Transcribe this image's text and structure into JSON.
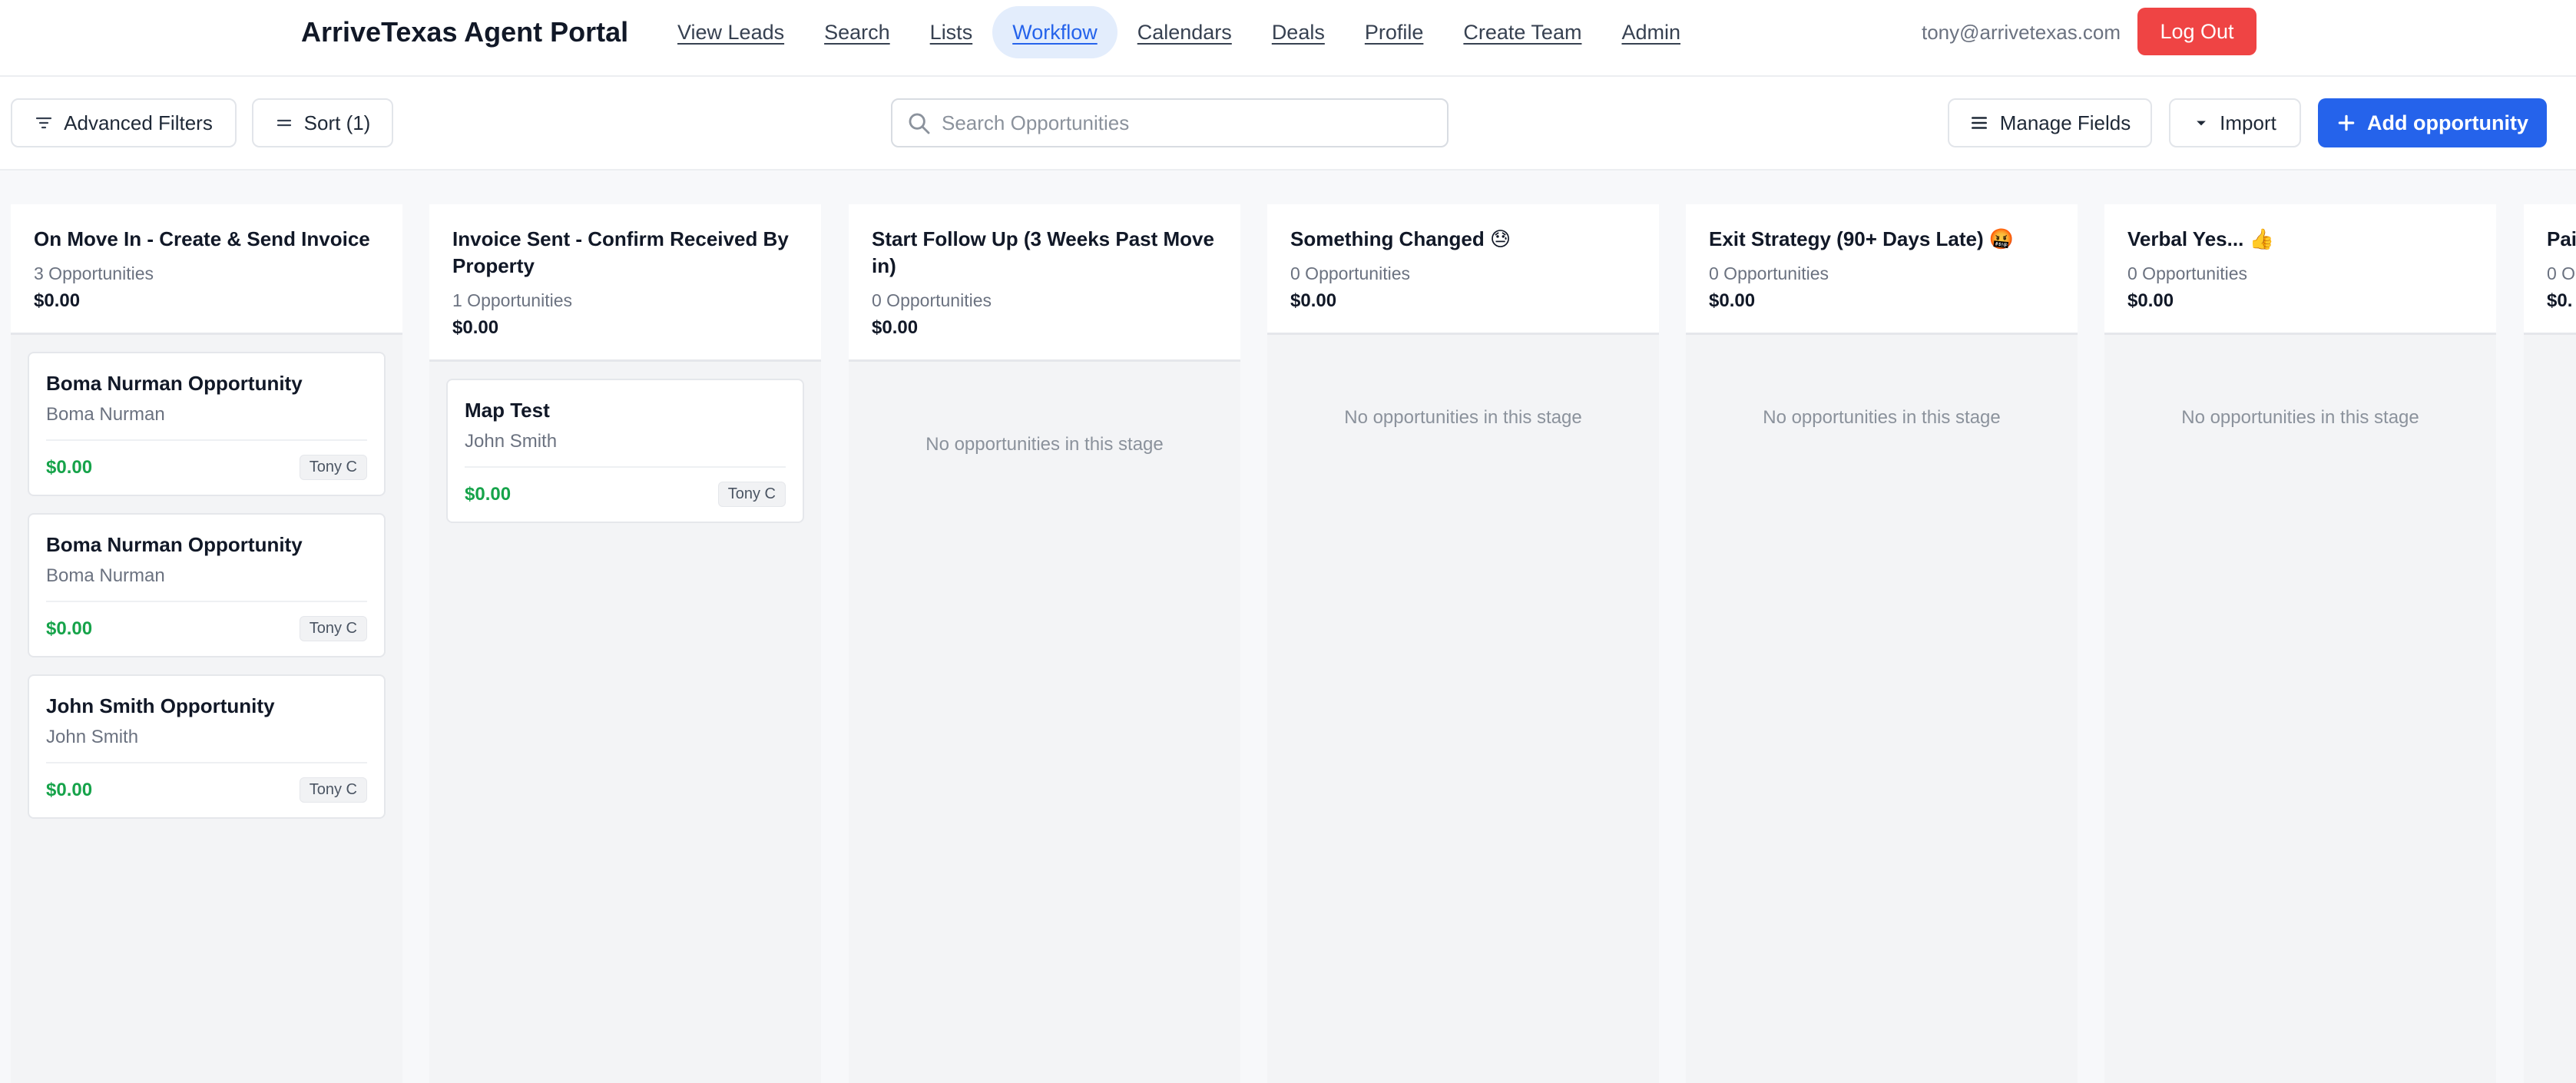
{
  "app": {
    "brand": "ArriveTexas Agent Portal",
    "nav": [
      {
        "label": "View Leads",
        "active": false
      },
      {
        "label": "Search",
        "active": false
      },
      {
        "label": "Lists",
        "active": false
      },
      {
        "label": "Workflow",
        "active": true
      },
      {
        "label": "Calendars",
        "active": false
      },
      {
        "label": "Deals",
        "active": false
      },
      {
        "label": "Profile",
        "active": false
      },
      {
        "label": "Create Team",
        "active": false
      },
      {
        "label": "Admin",
        "active": false
      }
    ],
    "user_email": "tony@arrivetexas.com",
    "logout_label": "Log Out"
  },
  "toolbar": {
    "advanced_filters_label": "Advanced Filters",
    "sort_label": "Sort (1)",
    "search_placeholder": "Search Opportunities",
    "manage_fields_label": "Manage Fields",
    "import_label": "Import",
    "add_opportunity_label": "Add opportunity"
  },
  "colors": {
    "primary": "#2563eb",
    "danger": "#ef4444",
    "amount_green": "#16a34a"
  },
  "columns": [
    {
      "title": "On Move In - Create & Send Invoice",
      "count": "3 Opportunities",
      "amount": "$0.00",
      "cards": [
        {
          "title": "Boma Nurman Opportunity",
          "contact": "Boma Nurman",
          "amount": "$0.00",
          "owner": "Tony C"
        },
        {
          "title": "Boma Nurman Opportunity",
          "contact": "Boma Nurman",
          "amount": "$0.00",
          "owner": "Tony C"
        },
        {
          "title": "John Smith Opportunity",
          "contact": "John Smith",
          "amount": "$0.00",
          "owner": "Tony C"
        }
      ]
    },
    {
      "title": "Invoice Sent - Confirm Received By Property",
      "count": "1 Opportunities",
      "amount": "$0.00",
      "cards": [
        {
          "title": "Map Test",
          "contact": "John Smith",
          "amount": "$0.00",
          "owner": "Tony C"
        }
      ]
    },
    {
      "title": "Start Follow Up (3 Weeks Past Move in)",
      "count": "0 Opportunities",
      "amount": "$0.00",
      "cards": []
    },
    {
      "title": "Something Changed 😓",
      "count": "0 Opportunities",
      "amount": "$0.00",
      "cards": []
    },
    {
      "title": "Exit Strategy (90+ Days Late) 🤬",
      "count": "0 Opportunities",
      "amount": "$0.00",
      "cards": []
    },
    {
      "title": "Verbal Yes... 👍",
      "count": "0 Opportunities",
      "amount": "$0.00",
      "cards": []
    },
    {
      "title": "Pai",
      "count": "0 O",
      "amount": "$0.",
      "cards": []
    }
  ],
  "empty_stage_message": "No opportunities in this stage"
}
